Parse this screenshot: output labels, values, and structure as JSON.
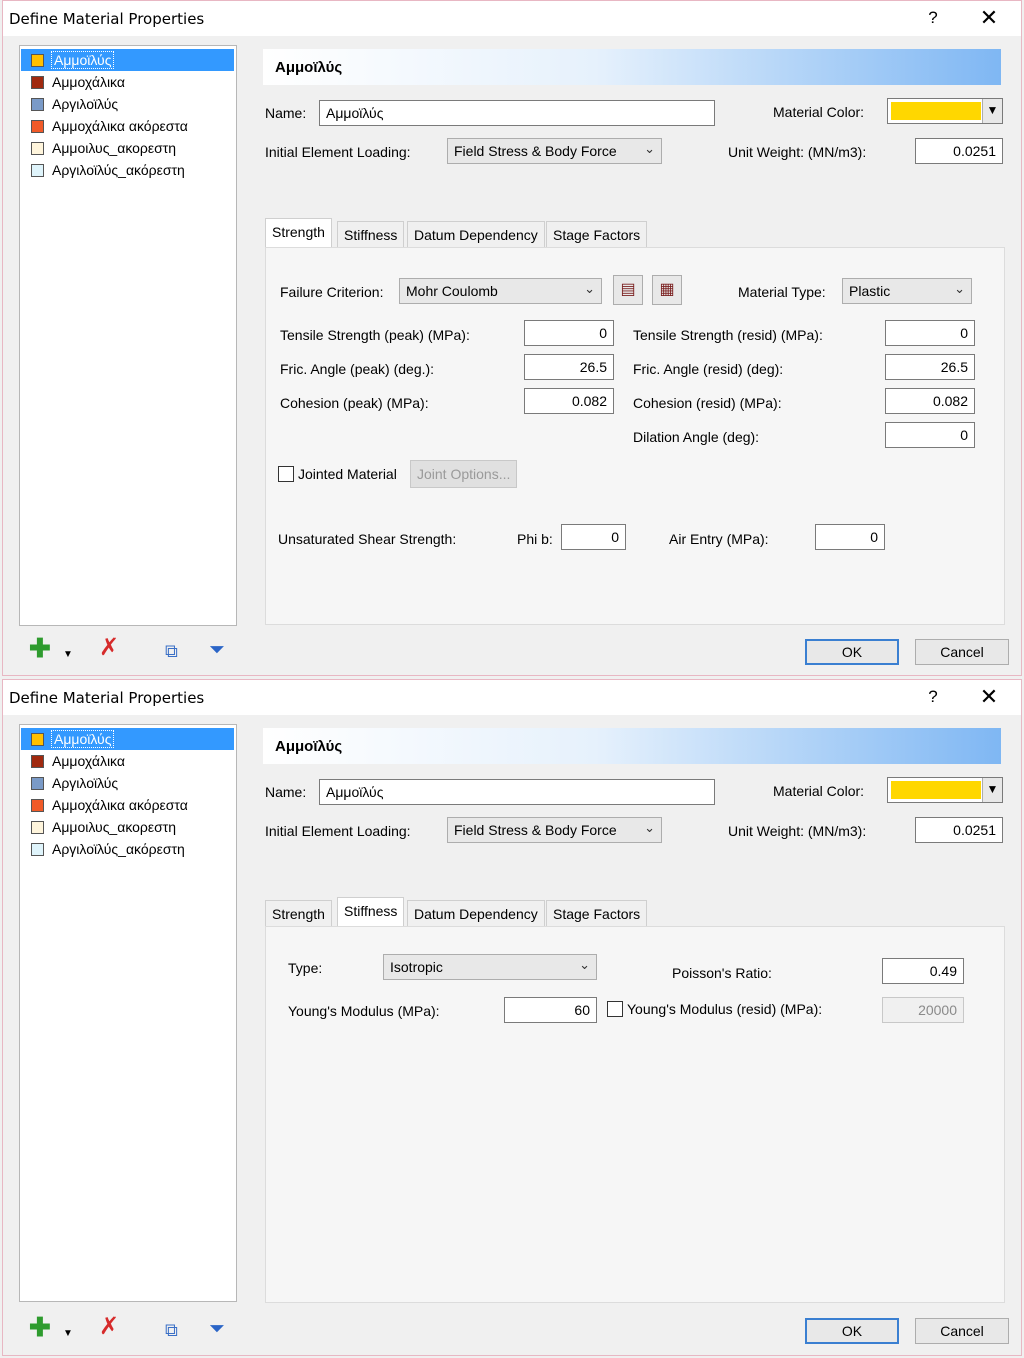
{
  "dialog": {
    "title": "Define Material Properties",
    "help_glyph": "?",
    "close_glyph": "✕"
  },
  "materials": [
    {
      "label": "Αμμοϊλύς",
      "color": "#ffc000"
    },
    {
      "label": "Αμμοχάλικα",
      "color": "#a0290f"
    },
    {
      "label": "Αργιλοϊλύς",
      "color": "#7a9ac7"
    },
    {
      "label": "Αμμοχάλικα ακόρεστα",
      "color": "#f05a28"
    },
    {
      "label": "Αμμοιλυς_ακορεστη",
      "color": "#fff5dc"
    },
    {
      "label": "Αργιλοϊλύς_ακόρεστη",
      "color": "#dff4fb"
    }
  ],
  "header": {
    "title": "Αμμοϊλύς"
  },
  "common": {
    "name_label": "Name:",
    "name_value": "Αμμοϊλύς",
    "material_color_label": "Material Color:",
    "material_color": "#ffd700",
    "initial_loading_label": "Initial Element Loading:",
    "initial_loading_value": "Field Stress & Body Force",
    "unit_weight_label": "Unit Weight: (MN/m3):",
    "unit_weight_value": "0.0251"
  },
  "tabs": [
    "Strength",
    "Stiffness",
    "Datum Dependency",
    "Stage Factors"
  ],
  "strength": {
    "failure_criterion_label": "Failure Criterion:",
    "failure_criterion_value": "Mohr Coulomb",
    "material_type_label": "Material Type:",
    "material_type_value": "Plastic",
    "tensile_peak_label": "Tensile Strength (peak) (MPa):",
    "tensile_peak_value": "0",
    "fric_peak_label": "Fric. Angle (peak) (deg.):",
    "fric_peak_value": "26.5",
    "cohesion_peak_label": "Cohesion (peak) (MPa):",
    "cohesion_peak_value": "0.082",
    "tensile_resid_label": "Tensile Strength (resid) (MPa):",
    "tensile_resid_value": "0",
    "fric_resid_label": "Fric. Angle (resid) (deg):",
    "fric_resid_value": "26.5",
    "cohesion_resid_label": "Cohesion (resid) (MPa):",
    "cohesion_resid_value": "0.082",
    "dilation_label": "Dilation Angle (deg):",
    "dilation_value": "0",
    "jointed_label": "Jointed Material",
    "joint_options_label": "Joint Options...",
    "unsat_label": "Unsaturated Shear Strength:",
    "phib_label": "Phi b:",
    "phib_value": "0",
    "air_entry_label": "Air Entry (MPa):",
    "air_entry_value": "0"
  },
  "stiffness": {
    "type_label": "Type:",
    "type_value": "Isotropic",
    "poisson_label": "Poisson's Ratio:",
    "poisson_value": "0.49",
    "youngs_label": "Young's Modulus (MPa):",
    "youngs_value": "60",
    "youngs_resid_label": "Young's Modulus (resid) (MPa):",
    "youngs_resid_value": "20000"
  },
  "buttons": {
    "ok": "OK",
    "cancel": "Cancel"
  },
  "icons": {
    "add": "plus-icon",
    "dropdown": "chevron-down-icon",
    "delete": "delete-icon",
    "copy": "copy-icon",
    "filter": "filter-icon"
  }
}
